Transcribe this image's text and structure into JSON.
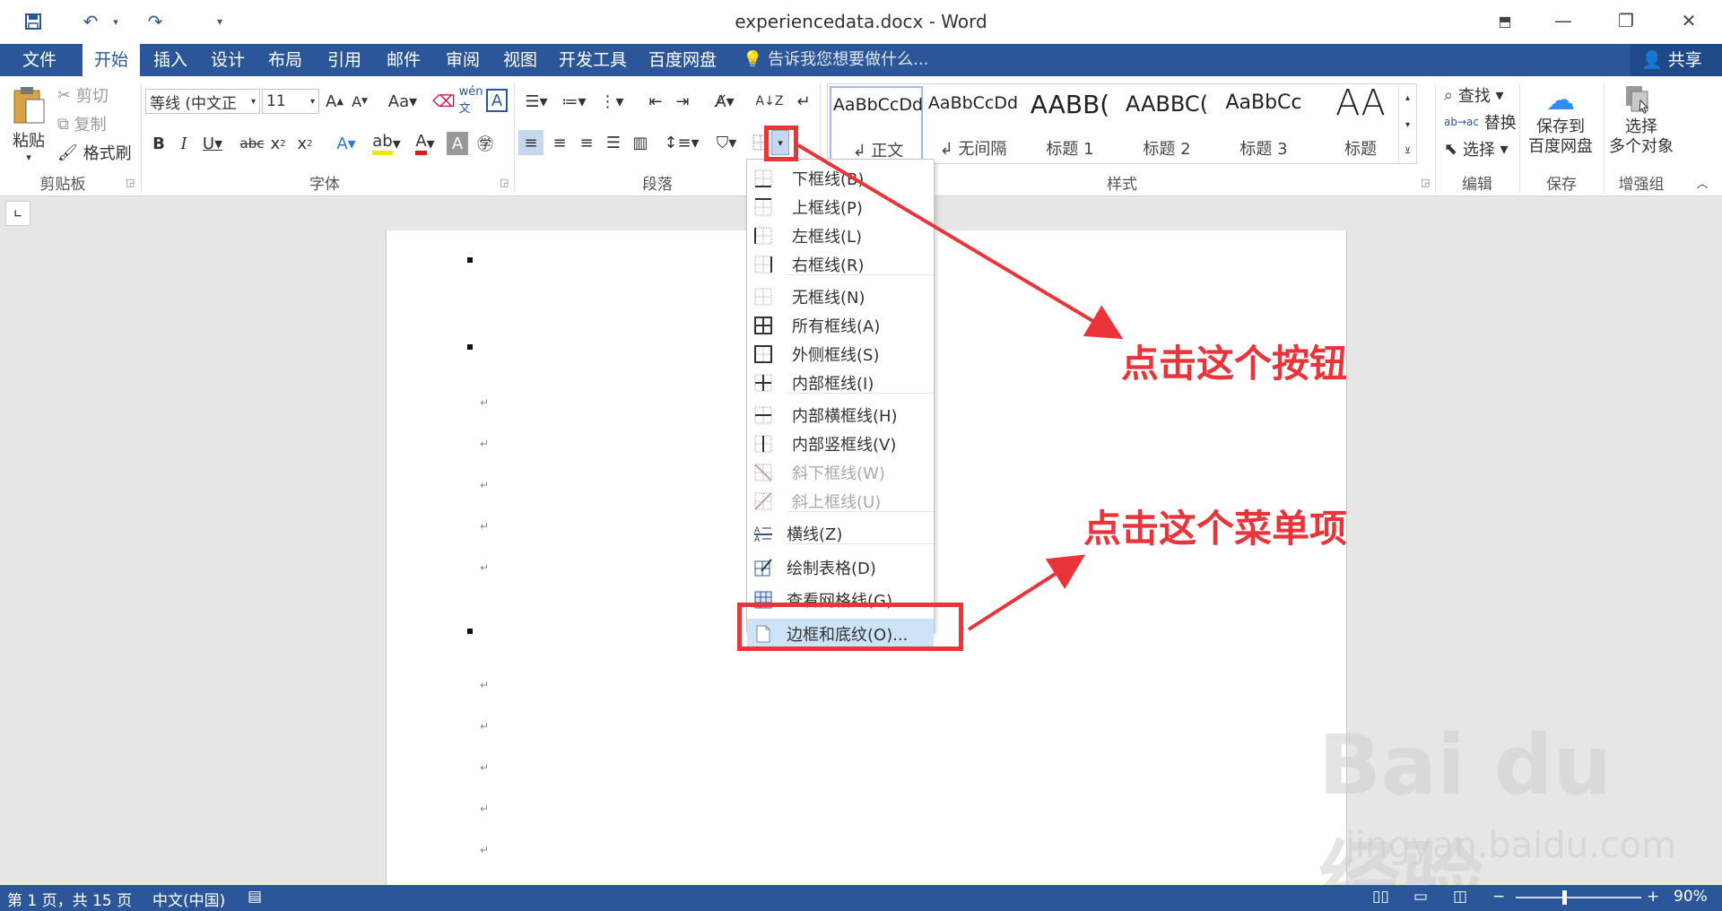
{
  "window": {
    "title": "experiencedata.docx - Word"
  },
  "tabs": [
    "文件",
    "开始",
    "插入",
    "设计",
    "布局",
    "引用",
    "邮件",
    "审阅",
    "视图",
    "开发工具",
    "百度网盘"
  ],
  "tell_me": "告诉我您想要做什么...",
  "share": "共享",
  "clipboard": {
    "paste": "粘贴",
    "cut": "剪切",
    "copy": "复制",
    "format_painter": "格式刷",
    "group": "剪贴板"
  },
  "font": {
    "name": "等线 (中文正",
    "size": "11",
    "group": "字体"
  },
  "paragraph": {
    "group": "段落"
  },
  "styles": {
    "items": [
      {
        "sample": "AaBbCcDd",
        "name": "↲ 正文"
      },
      {
        "sample": "AaBbCcDd",
        "name": "↲ 无间隔"
      },
      {
        "sample": "AABB(",
        "name": "标题 1"
      },
      {
        "sample": "AABBC(",
        "name": "标题 2"
      },
      {
        "sample": "AaBbCc",
        "name": "标题 3"
      },
      {
        "sample": "AA",
        "name": "标题"
      }
    ],
    "group": "样式"
  },
  "editing": {
    "find": "查找",
    "replace": "替换",
    "select": "选择",
    "group": "编辑"
  },
  "save": {
    "label1": "保存到",
    "label2": "百度网盘",
    "group": "保存"
  },
  "enhance": {
    "label1": "选择",
    "label2": "多个对象",
    "group": "增强组"
  },
  "border_menu": {
    "items": [
      {
        "label": "下框线(B)",
        "enabled": true
      },
      {
        "label": "上框线(P)",
        "enabled": true
      },
      {
        "label": "左框线(L)",
        "enabled": true
      },
      {
        "label": "右框线(R)",
        "enabled": true
      },
      {
        "label": "无框线(N)",
        "enabled": true
      },
      {
        "label": "所有框线(A)",
        "enabled": true
      },
      {
        "label": "外侧框线(S)",
        "enabled": true
      },
      {
        "label": "内部框线(I)",
        "enabled": true
      },
      {
        "label": "内部横框线(H)",
        "enabled": true
      },
      {
        "label": "内部竖框线(V)",
        "enabled": true
      },
      {
        "label": "斜下框线(W)",
        "enabled": false
      },
      {
        "label": "斜上框线(U)",
        "enabled": false
      },
      {
        "label": "横线(Z)",
        "enabled": true
      },
      {
        "label": "绘制表格(D)",
        "enabled": true
      },
      {
        "label": "查看网格线(G)",
        "enabled": true
      },
      {
        "label": "边框和底纹(O)...",
        "enabled": true,
        "highlighted": true
      }
    ]
  },
  "annotations": {
    "button": "点击这个按钮",
    "menu_item": "点击这个菜单项"
  },
  "status": {
    "page": "第 1 页，共 15 页",
    "language": "中文(中国)",
    "zoom": "90%"
  },
  "watermark": {
    "brand": "Bai du 经验",
    "url": "jingyan.baidu.com"
  }
}
